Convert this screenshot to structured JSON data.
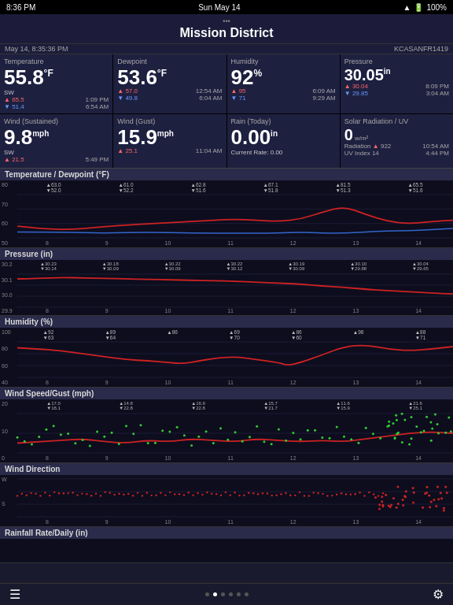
{
  "statusBar": {
    "time": "8:36 PM",
    "day": "Sun May 14",
    "wifi": "WiFi",
    "battery": "100%"
  },
  "titleBar": {
    "title": "Mission District",
    "dotsLabel": "•••"
  },
  "subtitleBar": {
    "left": "May 14, 8:35:36 PM",
    "right": "KCASANFR1419"
  },
  "tiles": [
    {
      "title": "Temperature",
      "value": "55.8",
      "unit": "°F",
      "direction": "SW",
      "rows": [
        {
          "arrow": "up",
          "val": "65.5",
          "time": "1:09 PM"
        },
        {
          "arrow": "down",
          "val": "51.4",
          "time": "6:54 AM"
        }
      ]
    },
    {
      "title": "Dewpoint",
      "value": "53.6",
      "unit": "°F",
      "rows": [
        {
          "arrow": "up",
          "val": "57.0",
          "time": "12:54 AM"
        },
        {
          "arrow": "down",
          "val": "49.8",
          "time": "6:04 AM"
        }
      ]
    },
    {
      "title": "Humidity",
      "value": "92",
      "unit": "%",
      "rows": [
        {
          "arrow": "up",
          "val": "95",
          "time": "6:09 AM"
        },
        {
          "arrow": "down",
          "val": "71",
          "time": "9:29 AM"
        }
      ]
    },
    {
      "title": "Pressure",
      "value": "30.05",
      "unit": "in",
      "rows": [
        {
          "arrow": "up",
          "val": "30.04",
          "time": "8:09 PM"
        },
        {
          "arrow": "down",
          "val": "29.85",
          "time": "3:04 AM"
        }
      ]
    },
    {
      "title": "Wind (Sustained)",
      "value": "9.8",
      "unit": "mph",
      "direction": "SW",
      "rows": [
        {
          "arrow": "up",
          "val": "21.5",
          "time": "5:49 PM"
        }
      ]
    },
    {
      "title": "Wind (Gust)",
      "value": "15.9",
      "unit": "mph",
      "rows": [
        {
          "arrow": "up",
          "val": "25.1",
          "time": "11:04 AM"
        }
      ]
    },
    {
      "title": "Rain (Today)",
      "value": "0.00",
      "unit": "in",
      "note": "Current Rate: 0.00"
    },
    {
      "title": "Solar Radiation / UV",
      "value": "0",
      "unit": "w/m²",
      "rows": [
        {
          "label": "Radiation",
          "arrow": "up",
          "val": "922",
          "time": "10:54 AM"
        },
        {
          "label": "UV Index",
          "val": "14",
          "time": "4:44 PM"
        }
      ]
    }
  ],
  "charts": [
    {
      "title": "Temperature / Dewpoint (°F)",
      "height": 85,
      "yLabels": [
        "80",
        "70",
        "60",
        "50"
      ],
      "xLabels": [
        "8",
        "9",
        "10",
        "11",
        "12",
        "13",
        "14"
      ],
      "annotations": [
        {
          "top": "63.0",
          "bot": "52.0"
        },
        {
          "top": "61.0",
          "bot": "52.2"
        },
        {
          "top": "62.8",
          "bot": "51.6"
        },
        {
          "top": "67.1",
          "bot": "51.8"
        },
        {
          "top": "81.5",
          "bot": "51.3"
        },
        {
          "top": "65.5",
          "bot": "51.6"
        }
      ]
    },
    {
      "title": "Pressure (in)",
      "height": 70,
      "yLabels": [
        "30.2",
        "30.1",
        "30.0",
        "29.9"
      ],
      "xLabels": [
        "8",
        "9",
        "10",
        "11",
        "12",
        "13",
        "14"
      ],
      "annotations": [
        {
          "top": "30.23",
          "bot": "30.14"
        },
        {
          "top": "30.18",
          "bot": "30.09"
        },
        {
          "top": "30.22",
          "bot": "30.09"
        },
        {
          "top": "30.22",
          "bot": "30.12"
        },
        {
          "top": "30.19",
          "bot": "30.09"
        },
        {
          "top": "30.10",
          "bot": "29.88"
        },
        {
          "top": "30.04",
          "bot": "29.65"
        }
      ]
    },
    {
      "title": "Humidity (%)",
      "height": 75,
      "yLabels": [
        "100",
        "80",
        "60",
        "40"
      ],
      "xLabels": [
        "8",
        "9",
        "10",
        "11",
        "12",
        "13",
        "14"
      ],
      "annotations": [
        {
          "top": "92",
          "bot": "63"
        },
        {
          "top": "89",
          "bot": "64"
        },
        {
          "top": "86",
          "bot": ""
        },
        {
          "top": "69",
          "bot": "70"
        },
        {
          "top": "86",
          "bot": "60"
        },
        {
          "top": "98",
          "bot": ""
        },
        {
          "top": "88",
          "bot": "71"
        }
      ]
    },
    {
      "title": "Wind Speed/Gust (mph)",
      "height": 80,
      "yLabels": [
        "20",
        "10",
        "0"
      ],
      "xLabels": [
        "8",
        "9",
        "10",
        "11",
        "12",
        "13",
        "14"
      ],
      "annotations": [
        {
          "top": "17.0",
          "bot": "18.1"
        },
        {
          "top": "14.8",
          "bot": "22.8"
        },
        {
          "top": "16.9",
          "bot": "22.8"
        },
        {
          "top": "15.7",
          "bot": "21.7"
        },
        {
          "top": "11.6",
          "bot": "15.9"
        },
        {
          "top": "21.6",
          "bot": "25.1"
        }
      ]
    },
    {
      "title": "Wind Direction",
      "height": 65,
      "yLabels": [
        "W",
        "S",
        ""
      ],
      "xLabels": [
        "8",
        "9",
        "10",
        "11",
        "12",
        "13",
        "14"
      ]
    },
    {
      "title": "Rainfall Rate/Daily (in)",
      "height": 30,
      "yLabels": [],
      "xLabels": []
    }
  ],
  "bottomNav": {
    "menuIcon": "☰",
    "settingsIcon": "⚙",
    "dots": [
      false,
      true,
      false,
      false,
      false,
      false
    ]
  }
}
